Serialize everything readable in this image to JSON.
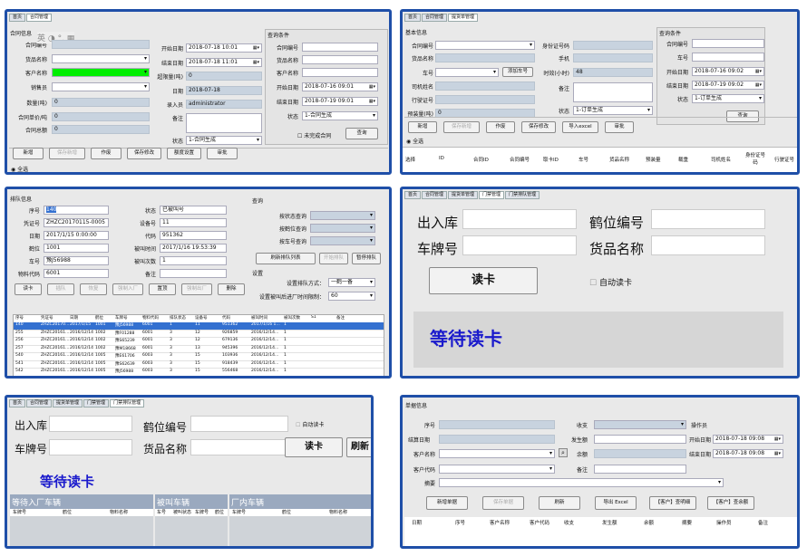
{
  "p1": {
    "tabs": [
      "首页",
      "合同管理"
    ],
    "group_title": "合同信息",
    "ime": "英 ◑ °, ▦",
    "labels": {
      "contract_no": "合同编号",
      "goods": "货品名称",
      "customer": "客户名称",
      "sales": "销售员",
      "qty": "数量(吨)",
      "price": "合同单价/吨",
      "amount": "合同总额",
      "start": "开始日期",
      "end": "结束日期",
      "surplus": "超限量(吨)",
      "date": "日期",
      "entry": "录入员",
      "remark": "备注",
      "status": "状态"
    },
    "values": {
      "start": "2018-07-18 10:01",
      "end": "2018-07-18 11:01",
      "surplus": "0",
      "date": "2018-07-18",
      "entry": "administrator",
      "qty": "0",
      "price": "0",
      "amount": "0",
      "status": "1-合同生成"
    },
    "query": {
      "title": "查询条件",
      "labels": [
        "合同编号",
        "货品名称",
        "客户名称",
        "开始日期",
        "结束日期",
        "状态"
      ],
      "start": "2018-07-16 09:01",
      "end": "2018-07-19 09:01",
      "status": "1-合同生成",
      "unfinished": "未完成合同",
      "btn": "查询"
    },
    "buttons": [
      "新增",
      "保存新增",
      "作废",
      "保存修改",
      "额度设置",
      "审批"
    ],
    "select_all": "全选"
  },
  "p2": {
    "tabs": [
      "首页",
      "合同管理",
      "提货单管理"
    ],
    "group_title": "基本信息",
    "labels": [
      "合同编号",
      "货品名称",
      "车号",
      "司机姓名",
      "行驶证号",
      "预装量(吨)",
      "身份证号码",
      "手机",
      "时效(小时)",
      "备注",
      "状态"
    ],
    "add_car": "添加车号",
    "hours": "48",
    "preload": "0",
    "status": "1-订单生成",
    "query": {
      "title": "查询条件",
      "labels": [
        "合同编号",
        "车号",
        "开始日期",
        "结束日期",
        "状态"
      ],
      "start": "2018-07-16 09:02",
      "end": "2018-07-19 09:02",
      "status": "1-订单生成",
      "btn": "查询"
    },
    "buttons": [
      "新增",
      "保存新增",
      "作废",
      "保存修改",
      "导入excel",
      "审批"
    ],
    "select_all": "全选",
    "cols": [
      "选择",
      "ID",
      "合同ID",
      "合同编号",
      "取卡ID",
      "车号",
      "货品名称",
      "预装量",
      "载重",
      "司机姓名",
      "身份证号码",
      "行驶证号"
    ]
  },
  "p3": {
    "group_title": "排队信息",
    "labels": [
      "序号",
      "凭证号",
      "日期",
      "鹤位",
      "车号",
      "物料代码",
      "状态",
      "设备号",
      "代码",
      "被叫时间",
      "被叫次数",
      "备注"
    ],
    "values": [
      "140",
      "ZHZC20170115-0005",
      "2017/1/15 0:00:00",
      "1001",
      "豫J56988",
      "6001",
      "已被叫号",
      "11",
      "951362",
      "2017/1/16 19:53:39",
      "1",
      ""
    ],
    "query": {
      "title": "查询",
      "labels": [
        "按状态查询",
        "按鹤位查询",
        "按车号查询"
      ],
      "refresh": "刷新排队列表",
      "start": "开始排队",
      "pause": "暂停排队",
      "settings": "设置",
      "mode_label": "设置排队方式：",
      "mode": "一鹤一备",
      "limit_label": "设置被叫后进厂时间限制：",
      "limit": "60"
    },
    "buttons": [
      "读卡",
      "插队",
      "恢复",
      "强制入厂",
      "置顶",
      "强制出厂",
      "删除"
    ],
    "cols": [
      "序号",
      "凭证号",
      "日期",
      "鹤位",
      "车牌号",
      "物料代码",
      "排队状态",
      "设备号",
      "代码",
      "被叫时间",
      "被叫次数",
      "S1",
      "备注"
    ],
    "rows": [
      [
        "140",
        "ZHZC20170…",
        "2017/1/15",
        "1001",
        "豫J56988",
        "6001",
        "1",
        "11",
        "951362",
        "2017/1/16 1…",
        "1",
        "",
        ""
      ],
      [
        "255",
        "ZHZC20161…",
        "2016/12/14",
        "1002",
        "豫F01288",
        "6001",
        "3",
        "12",
        "926859",
        "2016/12/14…",
        "1",
        "",
        ""
      ],
      [
        "256",
        "ZHZC20161…",
        "2016/12/14",
        "1002",
        "豫S65239",
        "6001",
        "3",
        "12",
        "679136",
        "2016/12/14…",
        "1",
        "",
        ""
      ],
      [
        "257",
        "ZHZC20161…",
        "2016/12/14",
        "1002",
        "豫M18668",
        "6001",
        "3",
        "13",
        "945396",
        "2016/12/14…",
        "1",
        "",
        ""
      ],
      [
        "540",
        "ZHZC20161…",
        "2016/12/14",
        "1005",
        "豫E61706",
        "6003",
        "3",
        "15",
        "103936",
        "2016/12/14…",
        "1",
        "",
        ""
      ],
      [
        "541",
        "ZHZC20161…",
        "2016/12/14",
        "1005",
        "豫S62639",
        "6003",
        "3",
        "15",
        "918439",
        "2016/12/14…",
        "1",
        "",
        ""
      ],
      [
        "542",
        "ZHZC20161…",
        "2016/12/14",
        "1005",
        "豫J56988",
        "6003",
        "3",
        "15",
        "556468",
        "2016/12/14…",
        "1",
        "",
        ""
      ]
    ]
  },
  "p4": {
    "tabs": [
      "首页",
      "合同管理",
      "提货单管理",
      "门禁管理",
      "门禁排队管理"
    ],
    "labels": [
      "出入库",
      "车牌号",
      "鹤位编号",
      "货品名称"
    ],
    "read": "读卡",
    "auto": "自动读卡",
    "waiting": "等待读卡"
  },
  "p5": {
    "tabs": [
      "首页",
      "合同管理",
      "提货单管理",
      "门禁管理",
      "门禁排队管理"
    ],
    "labels": [
      "出入库",
      "车牌号",
      "鹤位编号",
      "货品名称"
    ],
    "auto": "自动读卡",
    "read": "读卡",
    "refresh": "刷新",
    "waiting": "等待读卡",
    "sections": [
      {
        "title": "等待入厂车辆",
        "cols": [
          "车牌号",
          "鹤位",
          "物料名称"
        ]
      },
      {
        "title": "被叫车辆",
        "cols": [
          "车号",
          "被叫状态",
          "车牌号",
          "鹤位"
        ]
      },
      {
        "title": "厂内车辆",
        "cols": [
          "车牌号",
          "鹤位",
          "物料名称"
        ]
      }
    ]
  },
  "p6": {
    "group_title": "单据信息",
    "labels": [
      "序号",
      "结算日期",
      "客户名称",
      "客户代码",
      "摘要",
      "收支",
      "发生额",
      "余额",
      "备注",
      "操作员",
      "开始日期",
      "结束日期"
    ],
    "start": "2018-07-18 09:08",
    "end": "2018-07-18 09:08",
    "buttons": [
      "新增单据",
      "保存单据",
      "刷新",
      "导出 Excel",
      "【客户】查明细",
      "【客户】查余额"
    ],
    "cols": [
      "日期",
      "序号",
      "客户名称",
      "客户代码",
      "收支",
      "发生额",
      "余额",
      "摘要",
      "操作员",
      "备注"
    ]
  },
  "colors": {
    "border": "#1f4fa8",
    "green": "#00ee00",
    "waiting": "#1a1acc",
    "select": "#3370d0"
  }
}
